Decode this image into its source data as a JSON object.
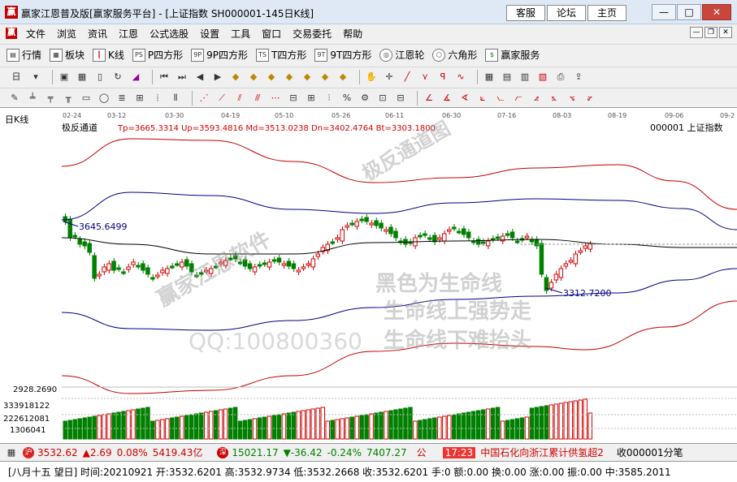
{
  "window": {
    "title": "赢家江恩普及版[赢家服务平台] - [上证指数  SH000001-145日K线]",
    "links": [
      "客服",
      "论坛",
      "主页"
    ],
    "controls": [
      "—",
      "□",
      "✕"
    ]
  },
  "menu": [
    "文件",
    "浏览",
    "资讯",
    "江恩",
    "公式选股",
    "设置",
    "工具",
    "窗口",
    "交易委托",
    "帮助"
  ],
  "toolbar1": [
    {
      "label": "行情",
      "icon": "quotes-icon"
    },
    {
      "label": "板块",
      "icon": "sector-icon"
    },
    {
      "label": "K线",
      "icon": "kline-icon"
    },
    {
      "label": "P四方形",
      "icon": "p-square-icon"
    },
    {
      "label": "9P四方形",
      "icon": "9p-square-icon"
    },
    {
      "label": "T四方形",
      "icon": "t-square-icon"
    },
    {
      "label": "9T四方形",
      "icon": "9t-square-icon"
    },
    {
      "label": "江恩轮",
      "icon": "gann-wheel-icon"
    },
    {
      "label": "六角形",
      "icon": "hexagon-icon"
    },
    {
      "label": "赢家服务",
      "icon": "service-icon"
    }
  ],
  "toolbar2_period": "日",
  "chart": {
    "tab_label": "日K线",
    "indicator_name": "极反通道",
    "indicator_values": "Tp=3665.3314  Up=3593.4816  Md=3513.0238  Dn=3402.4764  Bt=3303.1800",
    "symbol": "000001  上证指数",
    "dates": [
      "02-24",
      "03-12",
      "03-30",
      "04-19",
      "05-10",
      "05-26",
      "06-11",
      "06-30",
      "07-16",
      "08-03",
      "08-19",
      "09-06",
      "09-2"
    ],
    "high_label": "3645.6499",
    "low_label": "3312.7200",
    "watermarks": [
      "赢家江恩软件",
      "极反通道图",
      "QQ:100800360",
      "黑色为生命线",
      "生命线上强势走",
      "生命线下难抬头"
    ],
    "volume_axis": [
      "2928.2690",
      "333918122",
      "222612081",
      "1306041"
    ],
    "colors": {
      "up": "#d40000",
      "down": "#008000",
      "outer": "#c00000",
      "mid": "#000000",
      "inner": "#000080"
    }
  },
  "chart_data": {
    "type": "candlestick",
    "title": "极反通道",
    "series": [
      {
        "name": "Tp",
        "last": 3665.3314
      },
      {
        "name": "Up",
        "last": 3593.4816
      },
      {
        "name": "Md",
        "last": 3513.0238
      },
      {
        "name": "Dn",
        "last": 3402.4764
      },
      {
        "name": "Bt",
        "last": 3303.18
      }
    ],
    "annotations": [
      {
        "text": "3645.6499",
        "type": "high"
      },
      {
        "text": "3312.7200",
        "type": "low"
      }
    ]
  },
  "ticker": {
    "sh_price": "3532.62",
    "sh_change": "▲2.69",
    "sh_pct": "0.08%",
    "sh_amount": "5419.43亿",
    "sz_price": "15021.17",
    "sz_change": "▼-36.42",
    "sz_pct": "-0.24%",
    "sz_amount": "7407.27",
    "notice_label": "公",
    "time": "17:23",
    "news": "中国石化向浙江累计供氢超2",
    "extra": "收000001分笔"
  },
  "status": {
    "text": "[八月十五  望日] 时间:20210921 开:3532.6201 高:3532.9734 低:3532.2668 收:3532.6201 手:0 额:0.00 换:0.00 涨:0.00 振:0.00 中:3585.2011"
  }
}
